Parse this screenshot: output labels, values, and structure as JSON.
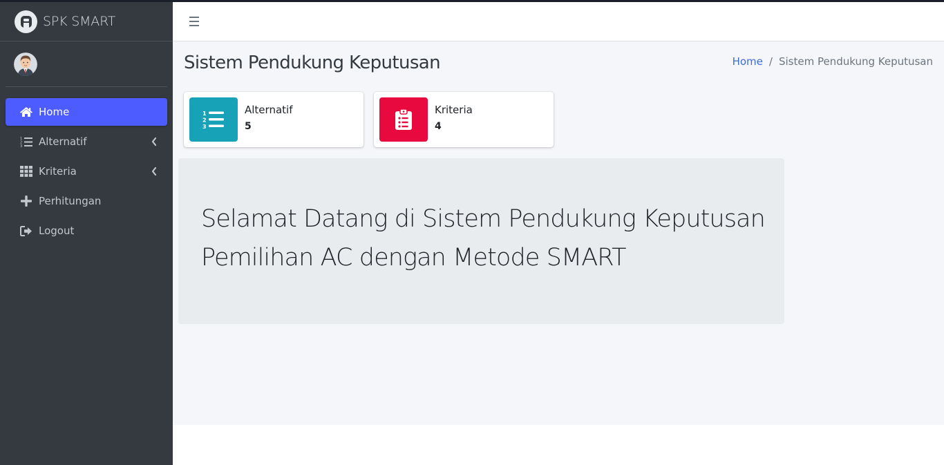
{
  "app": {
    "brand_name": "SPK SMART",
    "colors": {
      "sidebar_bg": "#343a40",
      "active_nav": "#4d5cff",
      "alternatif_box": "#17a2b8",
      "kriteria_box": "#e8093f",
      "link": "#3f6ad8"
    }
  },
  "sidebar": {
    "user_avatar": "user-avatar",
    "items": [
      {
        "label": "Home",
        "icon": "home-icon",
        "active": true,
        "has_submenu": false
      },
      {
        "label": "Alternatif",
        "icon": "list-ol-icon",
        "active": false,
        "has_submenu": true
      },
      {
        "label": "Kriteria",
        "icon": "grid-icon",
        "active": false,
        "has_submenu": true
      },
      {
        "label": "Perhitungan",
        "icon": "plus-icon",
        "active": false,
        "has_submenu": false
      },
      {
        "label": "Logout",
        "icon": "sign-out-icon",
        "active": false,
        "has_submenu": false
      }
    ]
  },
  "header": {
    "menu_icon": "hamburger-icon"
  },
  "content": {
    "title": "Sistem Pendukung Keputusan",
    "breadcrumb": [
      {
        "label": "Home",
        "link": true
      },
      {
        "label": "Sistem Pendukung Keputusan",
        "link": false
      }
    ],
    "breadcrumb_separator": "/",
    "info_boxes": [
      {
        "label": "Alternatif",
        "value": "5",
        "icon": "list-ol-icon"
      },
      {
        "label": "Kriteria",
        "value": "4",
        "icon": "clipboard-list-icon"
      }
    ],
    "welcome_line1": "Selamat Datang di Sistem Pendukung Keputusan",
    "welcome_line2": "Pemilihan AC dengan Metode SMART"
  }
}
